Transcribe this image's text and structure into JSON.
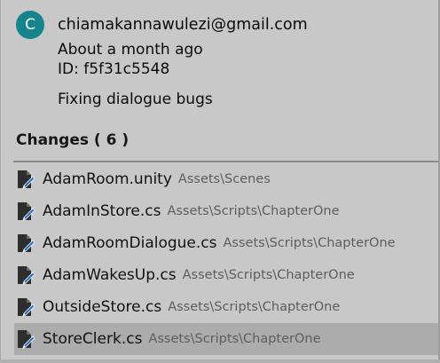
{
  "commit": {
    "avatar_letter": "C",
    "avatar_color": "#15848d",
    "email": "chiamakannawulezi@gmail.com",
    "time": "About a month ago",
    "id": "ID: f5f31c5548",
    "message": "Fixing dialogue bugs"
  },
  "changes": {
    "header": "Changes ( 6 )",
    "files": [
      {
        "name": "AdamRoom.unity",
        "path": "Assets\\Scenes",
        "icon": "edited-file-icon",
        "selected": false
      },
      {
        "name": "AdamInStore.cs",
        "path": "Assets\\Scripts\\ChapterOne",
        "icon": "edited-file-icon",
        "selected": false
      },
      {
        "name": "AdamRoomDialogue.cs",
        "path": "Assets\\Scripts\\ChapterOne",
        "icon": "edited-file-icon",
        "selected": false
      },
      {
        "name": "AdamWakesUp.cs",
        "path": "Assets\\Scripts\\ChapterOne",
        "icon": "edited-file-icon",
        "selected": false
      },
      {
        "name": "OutsideStore.cs",
        "path": "Assets\\Scripts\\ChapterOne",
        "icon": "edited-file-icon",
        "selected": false
      },
      {
        "name": "StoreClerk.cs",
        "path": "Assets\\Scripts\\ChapterOne",
        "icon": "edited-file-icon",
        "selected": true
      }
    ]
  },
  "colors": {
    "panel_background": "#c8c8c8",
    "selected_row": "#acacac",
    "edit_accent": "#1f6fd1"
  }
}
